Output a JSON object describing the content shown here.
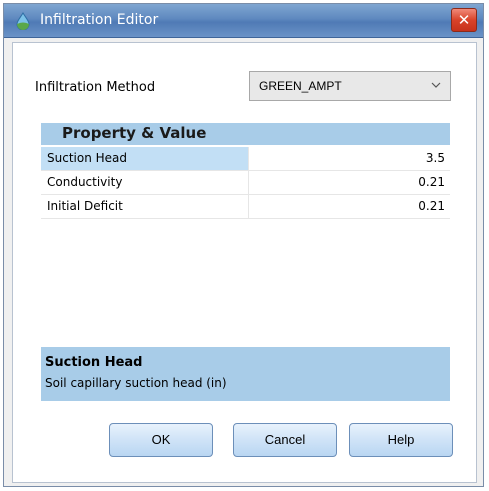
{
  "window": {
    "title": "Infiltration Editor",
    "close_label": "✕"
  },
  "method": {
    "label": "Infiltration Method",
    "selected": "GREEN_AMPT"
  },
  "grid": {
    "header": "Property  &  Value",
    "rows": [
      {
        "name": "Suction Head",
        "value": "3.5"
      },
      {
        "name": "Conductivity",
        "value": "0.21"
      },
      {
        "name": "Initial Deficit",
        "value": "0.21"
      }
    ],
    "selected_row": "Suction Head"
  },
  "description": {
    "title": "Suction Head",
    "text": "Soil capillary suction head (in)"
  },
  "buttons": {
    "ok": "OK",
    "cancel": "Cancel",
    "help": "Help"
  },
  "colors": {
    "titlebar": "#5e88bf",
    "header_band": "#a8cce8",
    "selected_cell": "#c2dff5",
    "close": "#d9432a"
  },
  "icons": {
    "app": "swmm-droplet-icon",
    "close": "close-icon",
    "dropdown": "chevron-down-icon"
  }
}
